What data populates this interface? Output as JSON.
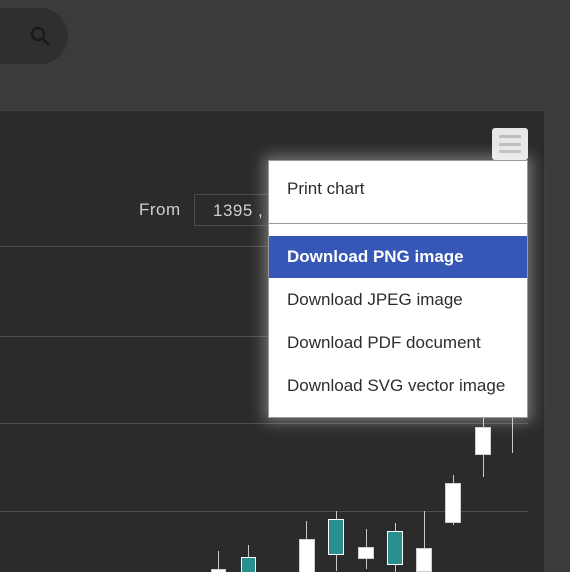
{
  "header": {
    "search_icon": "search-icon"
  },
  "chart": {
    "menu_icon": "hamburger-menu-icon",
    "range_from_label": "From",
    "range_from_value": "1395 ,"
  },
  "export_menu": {
    "items": [
      {
        "label": "Print chart",
        "active": false
      },
      {
        "label": "Download PNG image",
        "active": true
      },
      {
        "label": "Download JPEG image",
        "active": false
      },
      {
        "label": "Download PDF document",
        "active": false
      },
      {
        "label": "Download SVG vector image",
        "active": false
      }
    ]
  },
  "colors": {
    "page_background": "#3b3b3b",
    "chart_background": "#2b2b2b",
    "menu_highlight": "#3657b5",
    "candle_down": "#2a8f8f",
    "candle_up": "#ffffff"
  }
}
